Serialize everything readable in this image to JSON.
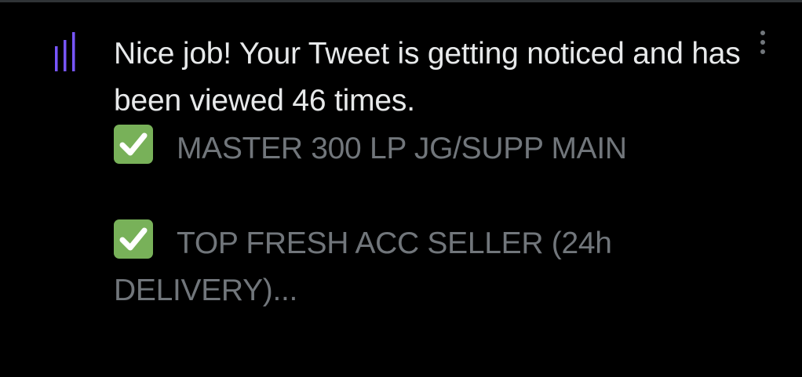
{
  "notification": {
    "icon": "analytics-bars-icon",
    "accent_color": "#7856ff",
    "headline": "Nice job! Your Tweet is getting noticed and has been viewed 46 times.",
    "tweet_preview": {
      "line1": "MASTER 300 LP JG/SUPP MAIN",
      "line2a": "TOP FRESH ACC SELLER (24h",
      "line2b": "DELIVERY)..."
    },
    "more_icon": "more-vertical-icon"
  }
}
